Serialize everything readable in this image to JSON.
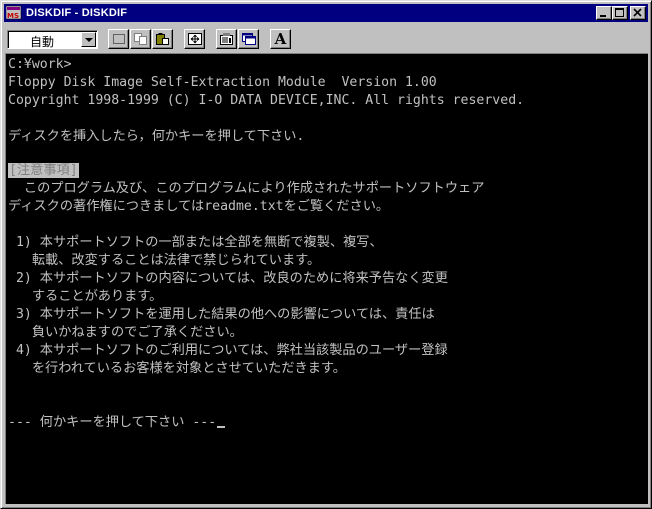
{
  "window": {
    "title": "DISKDIF - DISKDIF"
  },
  "toolbar": {
    "font_size_value": "自動",
    "icons": [
      "mark-icon",
      "copy-icon",
      "paste-icon",
      "fullscreen-icon",
      "properties-icon",
      "background-icon",
      "font-icon"
    ],
    "font_button_label": "A"
  },
  "console": {
    "lines": [
      "C:¥work>",
      "Floppy Disk Image Self-Extraction Module  Version 1.00",
      "Copyright 1998-1999 (C) I-O DATA DEVICE,INC. All rights reserved.",
      "",
      "ディスクを挿入したら，何かキーを押して下さい.",
      "",
      "",
      "  このプログラム及び、このプログラムにより作成されたサポートソフトウェア",
      "ディスクの著作権につきましてはreadme.txtをご覧ください。",
      "",
      " 1) 本サポートソフトの一部または全部を無断で複製、複写、",
      "   転載、改変することは法律で禁じられています。",
      " 2) 本サポートソフトの内容については、改良のために将来予告なく変更",
      "   することがあります。",
      " 3) 本サポートソフトを運用した結果の他への影響については、責任は",
      "   負いかねますのでご了承ください。",
      " 4) 本サポートソフトのご利用については、弊社当該製品のユーザー登録",
      "   を行われているお客様を対象とさせていただきます。",
      "",
      "",
      "",
      "--- 何かキーを押して下さい ---"
    ],
    "notice_label": "[注意事項]"
  },
  "colors": {
    "titlebar": "#000080",
    "console_bg": "#000000",
    "console_fg": "#c0c0c0",
    "chrome": "#c0c0c0"
  }
}
